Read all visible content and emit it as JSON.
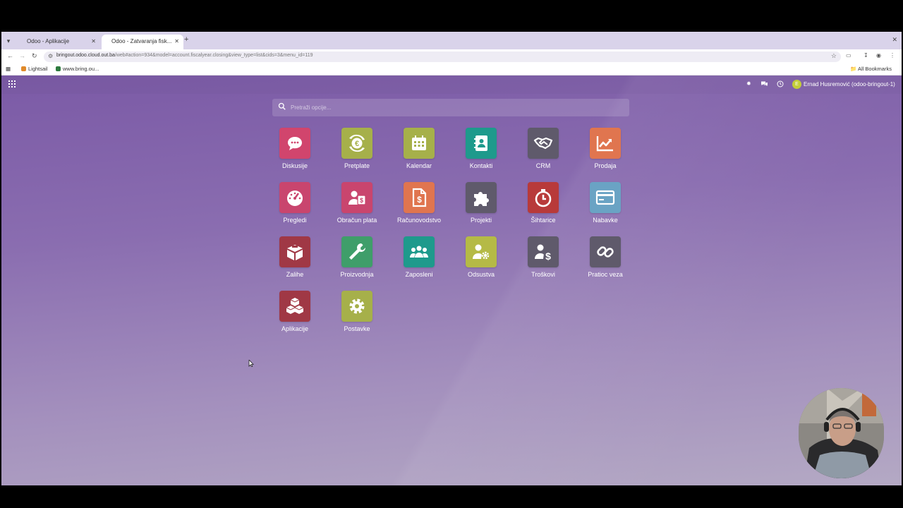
{
  "browser": {
    "tabs": [
      {
        "title": "Odoo - Aplikacije",
        "active": false
      },
      {
        "title": "Odoo - Zatvaranja fisk...",
        "active": true
      }
    ],
    "url_host": "bringout.odoo.cloud.out.ba",
    "url_path": "/web#action=934&model=account.fiscalyear.closing&view_type=list&cids=3&menu_id=119",
    "bookmarks": [
      {
        "label": "Lightsail",
        "color": "#e08a2a"
      },
      {
        "label": "www.bring.ou...",
        "color": "#2d7a3e"
      }
    ],
    "all_bookmarks": "All Bookmarks"
  },
  "odoo": {
    "user": {
      "initial": "E",
      "name": "Ernad Husremović (odoo-bringout-1)"
    },
    "search_placeholder": "Pretraži opcije...",
    "apps": [
      {
        "label": "Diskusije",
        "icon": "chat-icon",
        "color": "#d1456d"
      },
      {
        "label": "Pretplate",
        "icon": "euro-cycle-icon",
        "color": "#a6b04a"
      },
      {
        "label": "Kalendar",
        "icon": "calendar-icon",
        "color": "#a6b04a"
      },
      {
        "label": "Kontakti",
        "icon": "contact-book-icon",
        "color": "#1e9a8c"
      },
      {
        "label": "CRM",
        "icon": "handshake-icon",
        "color": "#5f5a6b"
      },
      {
        "label": "Prodaja",
        "icon": "trend-up-icon",
        "color": "#e0754f"
      },
      {
        "label": "Pregledi",
        "icon": "gauge-icon",
        "color": "#c9456e"
      },
      {
        "label": "Obračun plata",
        "icon": "payroll-icon",
        "color": "#c9456e"
      },
      {
        "label": "Računovodstvo",
        "icon": "invoice-icon",
        "color": "#e0754f"
      },
      {
        "label": "Projekti",
        "icon": "puzzle-icon",
        "color": "#5f5a6b"
      },
      {
        "label": "Šihtarice",
        "icon": "stopwatch-icon",
        "color": "#b83a3a"
      },
      {
        "label": "Nabavke",
        "icon": "credit-card-icon",
        "color": "#6aa3c4"
      },
      {
        "label": "Zalihe",
        "icon": "box-icon",
        "color": "#a03845"
      },
      {
        "label": "Proizvodnja",
        "icon": "wrench-icon",
        "color": "#3f9e6a"
      },
      {
        "label": "Zaposleni",
        "icon": "people-icon",
        "color": "#1e9a8c"
      },
      {
        "label": "Odsustva",
        "icon": "person-gear-icon",
        "color": "#b5ba46"
      },
      {
        "label": "Troškovi",
        "icon": "person-dollar-icon",
        "color": "#5f5a6b"
      },
      {
        "label": "Pratioc veza",
        "icon": "link-icon",
        "color": "#5f5a6b"
      },
      {
        "label": "Aplikacije",
        "icon": "cubes-icon",
        "color": "#a03845"
      },
      {
        "label": "Postavke",
        "icon": "gear-icon",
        "color": "#a6b04a"
      }
    ]
  }
}
